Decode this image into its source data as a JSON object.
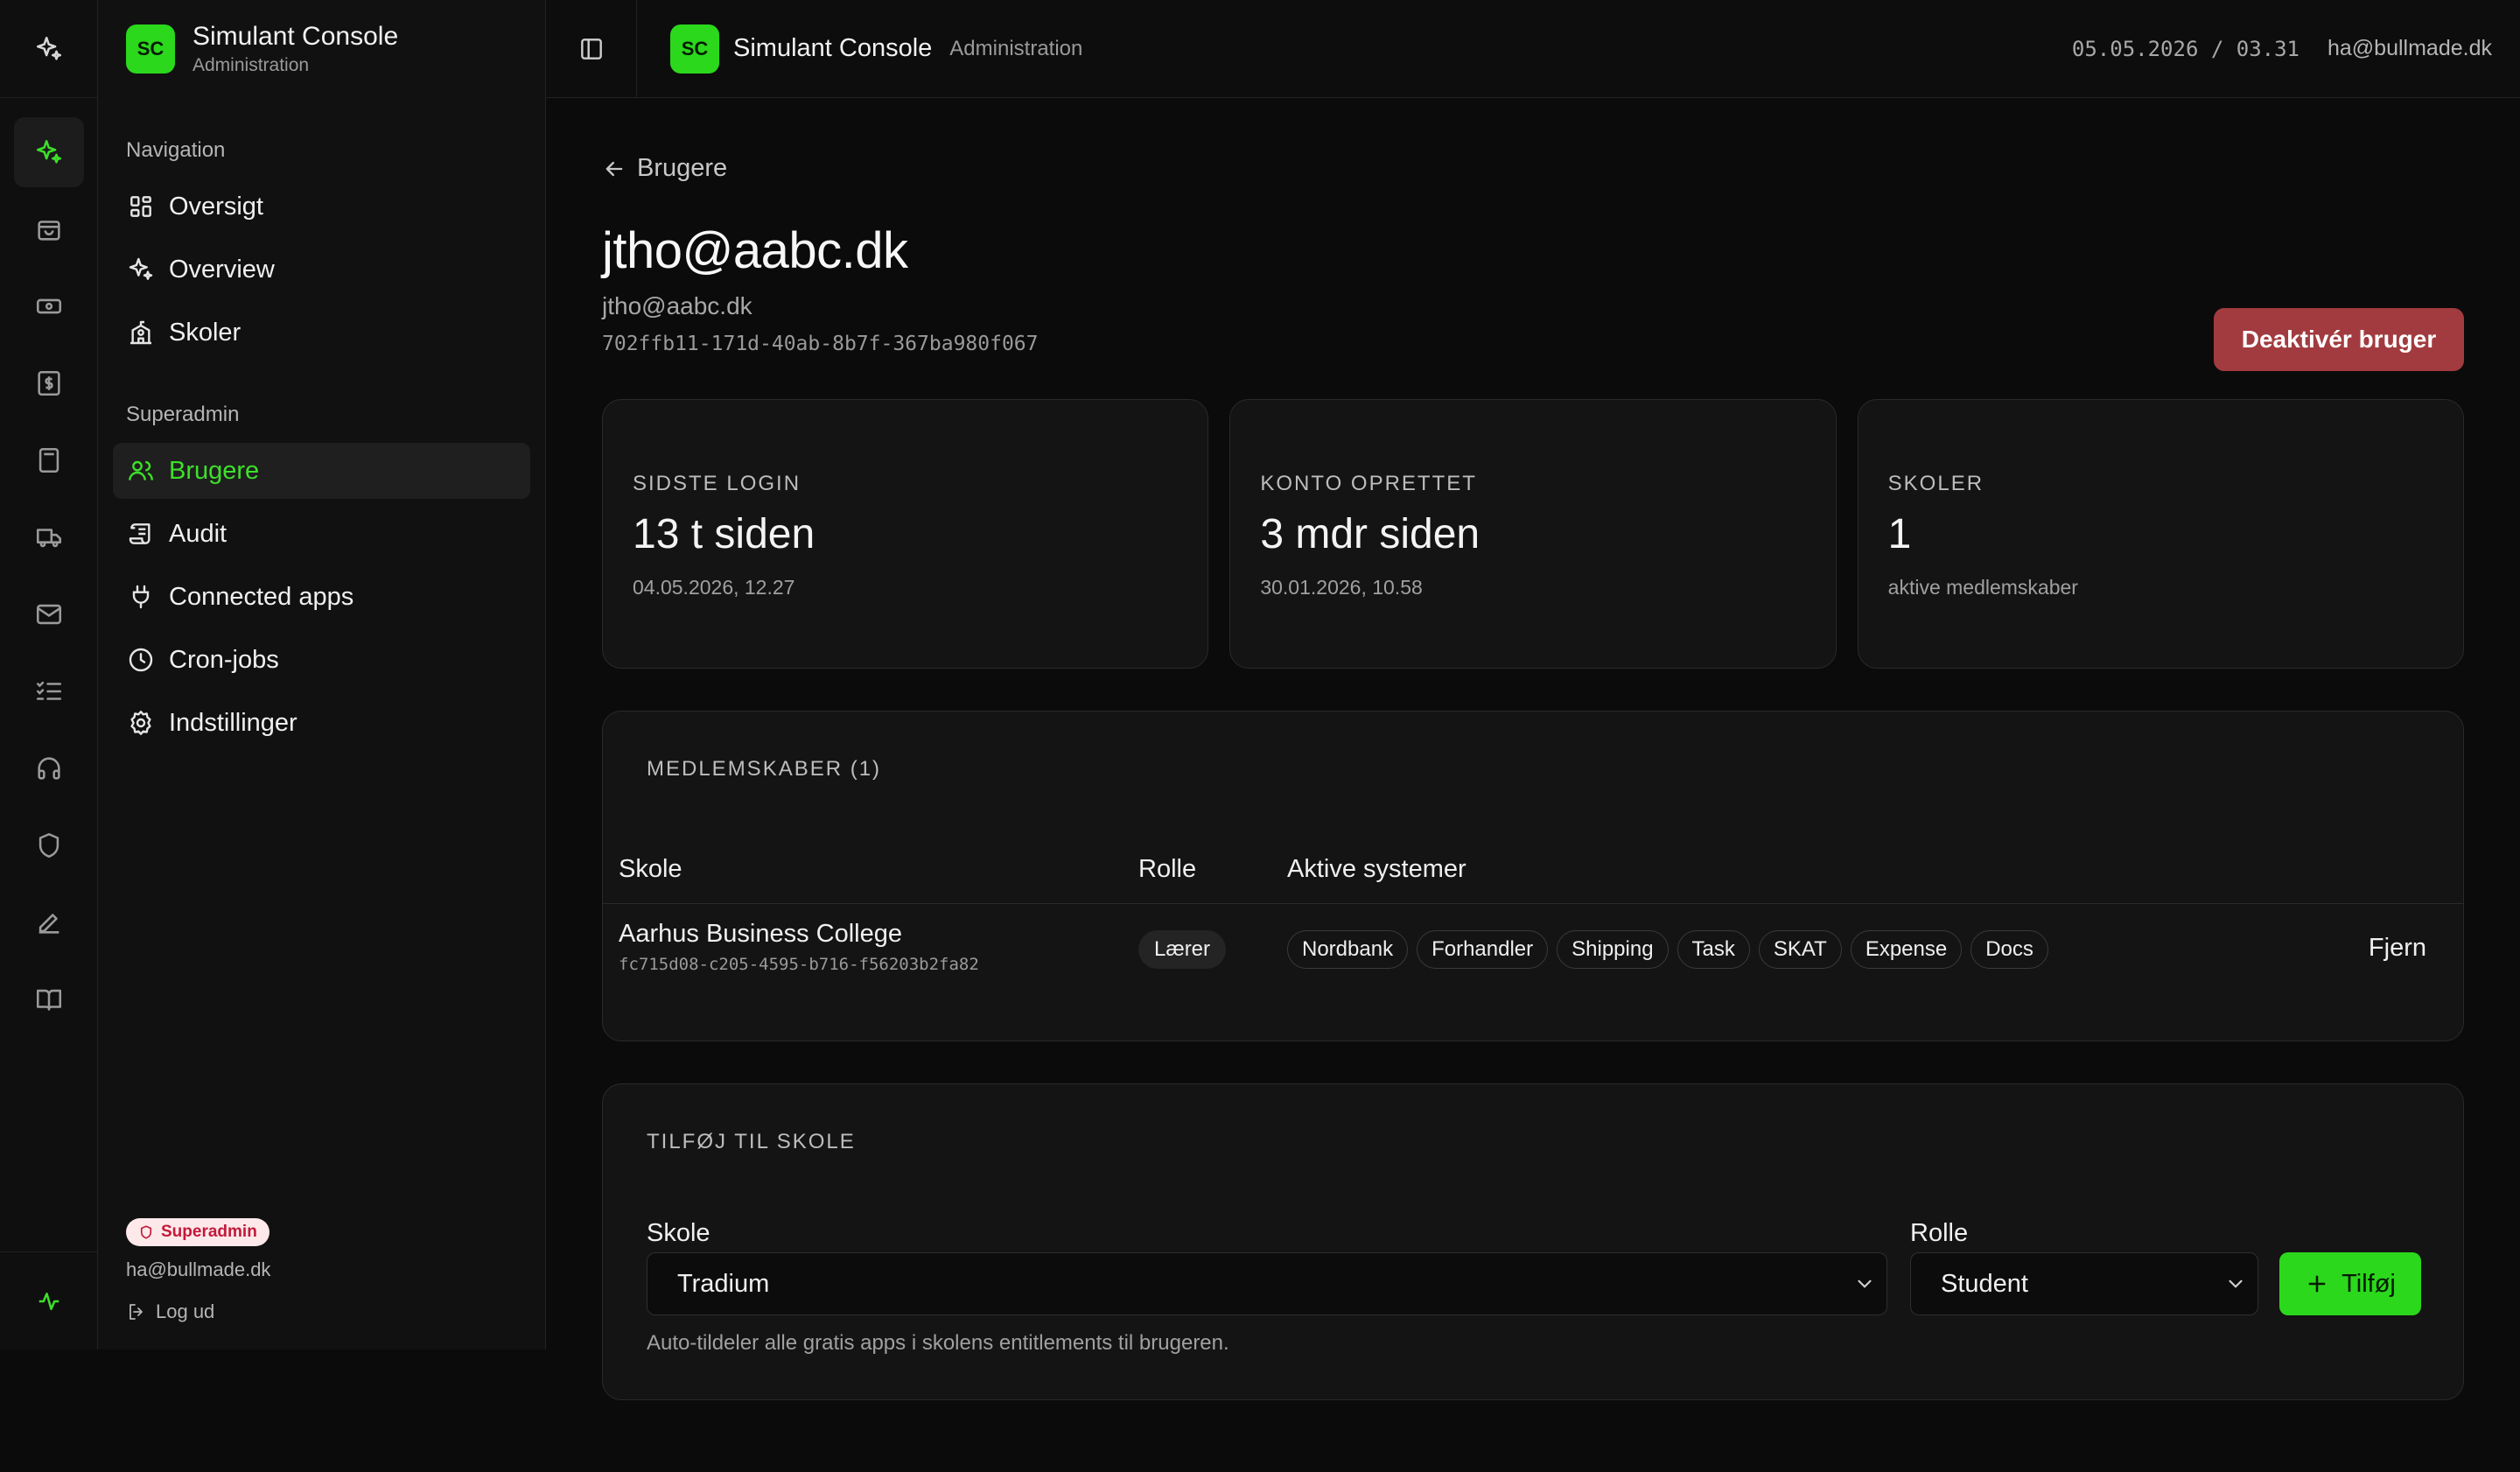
{
  "app": {
    "name": "Simulant Console",
    "subtitle": "Administration",
    "logo": "SC",
    "accent": "#2bd81c"
  },
  "rail": {
    "icons": [
      "sparkles-icon",
      "shopping-bag-icon",
      "banknote-icon",
      "dollar-icon",
      "calculator-icon",
      "truck-icon",
      "mail-icon",
      "checklist-icon",
      "headphones-icon",
      "shield-icon",
      "pen-icon",
      "book-icon"
    ],
    "active": "sparkles-icon",
    "status_icon": "activity-icon"
  },
  "sidebar": {
    "nav_label": "Navigation",
    "nav_items": [
      {
        "label": "Oversigt",
        "icon": "grid-icon"
      },
      {
        "label": "Overview",
        "icon": "sparkles-icon"
      },
      {
        "label": "Skoler",
        "icon": "school-icon"
      }
    ],
    "admin_label": "Superadmin",
    "admin_items": [
      {
        "label": "Brugere",
        "icon": "users-icon",
        "active": true
      },
      {
        "label": "Audit",
        "icon": "scroll-icon"
      },
      {
        "label": "Connected apps",
        "icon": "plug-icon"
      },
      {
        "label": "Cron-jobs",
        "icon": "clock-icon"
      },
      {
        "label": "Indstillinger",
        "icon": "gear-icon"
      }
    ],
    "footer": {
      "badge": "Superadmin",
      "email": "ha@bullmade.dk",
      "logout": "Log ud"
    }
  },
  "topbar": {
    "datetime": "05.05.2026 / 03.31",
    "email": "ha@bullmade.dk"
  },
  "page": {
    "back_label": "Brugere",
    "title": "jtho@aabc.dk",
    "email": "jtho@aabc.dk",
    "user_id": "702ffb11-171d-40ab-8b7f-367ba980f067",
    "deactivate_label": "Deaktivér bruger",
    "deactivate_color": "#a23b3f"
  },
  "stats": [
    {
      "label": "SIDSTE LOGIN",
      "value": "13 t siden",
      "sub": "04.05.2026, 12.27"
    },
    {
      "label": "KONTO OPRETTET",
      "value": "3 mdr siden",
      "sub": "30.01.2026, 10.58"
    },
    {
      "label": "SKOLER",
      "value": "1",
      "sub": "aktive medlemskaber"
    }
  ],
  "memberships": {
    "title": "MEDLEMSKABER (1)",
    "columns": {
      "school": "Skole",
      "role": "Rolle",
      "systems": "Aktive systemer"
    },
    "rows": [
      {
        "school": "Aarhus Business College",
        "school_id": "fc715d08-c205-4595-b716-f56203b2fa82",
        "role": "Lærer",
        "systems": [
          "Nordbank",
          "Forhandler",
          "Shipping",
          "Task",
          "SKAT",
          "Expense",
          "Docs"
        ],
        "remove": "Fjern"
      }
    ]
  },
  "add_to_school": {
    "title": "TILFØJ TIL SKOLE",
    "school_label": "Skole",
    "school_value": "Tradium",
    "role_label": "Rolle",
    "role_value": "Student",
    "add_label": "Tilføj",
    "hint": "Auto-tildeler alle gratis apps i skolens entitlements til brugeren."
  }
}
